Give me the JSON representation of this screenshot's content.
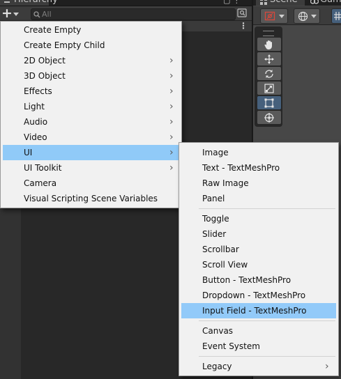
{
  "hierarchy": {
    "tab_title": "Hierarchy",
    "tab_buttons": "▢ ⋮",
    "add_button_label": "+",
    "search": {
      "placeholder": "All",
      "value": ""
    },
    "scene_row_more": "⋮"
  },
  "scene": {
    "tab_title": "Scene",
    "game_tab_title": "Game",
    "tools": [
      "hand-tool",
      "move-tool",
      "rotate-tool",
      "scale-tool",
      "rect-tool",
      "transform-tool"
    ],
    "active_tool": "rect-tool"
  },
  "menu": {
    "items": [
      {
        "label": "Create Empty",
        "submenu": false
      },
      {
        "label": "Create Empty Child",
        "submenu": false
      },
      {
        "label": "2D Object",
        "submenu": true
      },
      {
        "label": "3D Object",
        "submenu": true
      },
      {
        "label": "Effects",
        "submenu": true
      },
      {
        "label": "Light",
        "submenu": true
      },
      {
        "label": "Audio",
        "submenu": true
      },
      {
        "label": "Video",
        "submenu": true
      },
      {
        "label": "UI",
        "submenu": true,
        "highlighted": true
      },
      {
        "label": "UI Toolkit",
        "submenu": true
      },
      {
        "label": "Camera",
        "submenu": false
      },
      {
        "label": "Visual Scripting Scene Variables",
        "submenu": false
      }
    ],
    "arrow": "›"
  },
  "submenu": {
    "groups": [
      [
        "Image",
        "Text - TextMeshPro",
        "Raw Image",
        "Panel"
      ],
      [
        "Toggle",
        "Slider",
        "Scrollbar",
        "Scroll View",
        "Button - TextMeshPro",
        "Dropdown - TextMeshPro",
        "Input Field - TextMeshPro"
      ],
      [
        "Canvas",
        "Event System"
      ],
      [
        "Legacy"
      ]
    ],
    "highlighted": "Input Field - TextMeshPro",
    "has_submenu": [
      "Legacy"
    ]
  },
  "colors": {
    "menu_bg": "#f1f1f1",
    "highlight": "#90caf8",
    "editor_bg": "#282828",
    "active_tool": "#46607c"
  }
}
